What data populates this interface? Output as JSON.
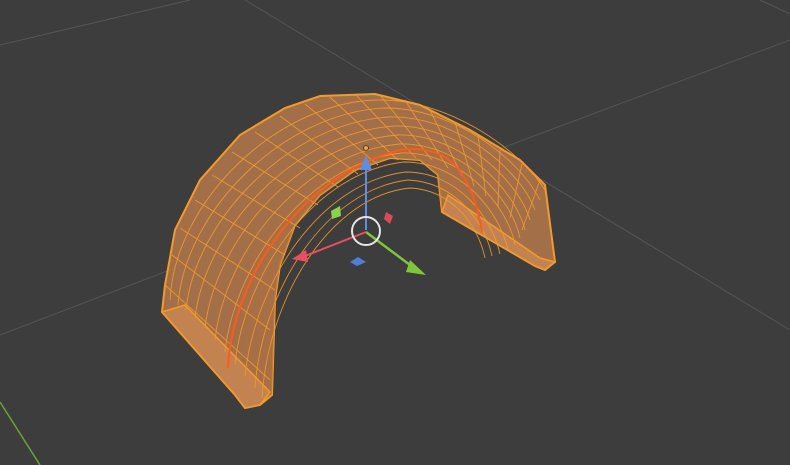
{
  "viewport": {
    "view": "3D Viewport",
    "mode": "edit-mode-wireframe",
    "colors": {
      "background": "#3d3d3d",
      "grid": "#555555",
      "mesh_fill": "#b97a4c",
      "mesh_wire": "#f39a2c",
      "selected_edge": "#ff5a1a",
      "axis_x": "#e8505f",
      "axis_y": "#7ec63a",
      "axis_z": "#5b8ee6",
      "cursor": "#dddddd"
    }
  },
  "gizmo": {
    "type": "translate",
    "icons": [
      "move-arrow-x-icon",
      "move-arrow-y-icon",
      "move-arrow-z-icon",
      "plane-handle-xy-icon",
      "plane-handle-xz-icon",
      "plane-handle-yz-icon",
      "pivot-circle-icon"
    ]
  },
  "object": {
    "shape": "curved-arch-mesh",
    "selected": true
  }
}
